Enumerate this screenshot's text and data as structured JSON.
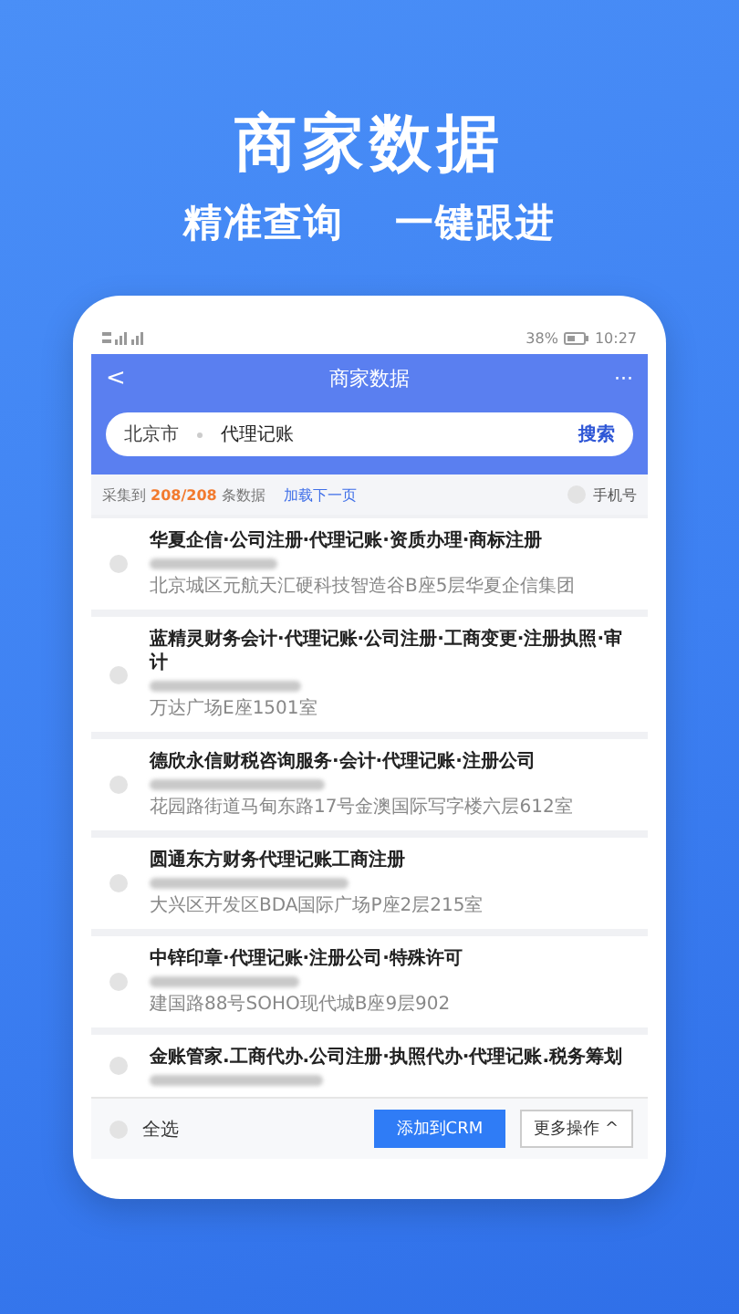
{
  "headline": "商家数据",
  "tagline": [
    "精准查询",
    "一键跟进"
  ],
  "status_bar": {
    "battery": "38%",
    "time": "10:27"
  },
  "app_bar": {
    "back": "<",
    "title": "商家数据",
    "more": "···"
  },
  "search": {
    "city": "北京市",
    "value": "代理记账",
    "button": "搜索"
  },
  "summary": {
    "prefix": "采集到",
    "count": "208/208",
    "suffix": "条数据",
    "next_page": "加载下一页",
    "phone_filter": {
      "label": "手机号",
      "checked": false
    }
  },
  "results": [
    {
      "title": "华夏企信·公司注册·代理记账·资质办理·商标注册",
      "address": "北京城区元航天汇硬科技智造谷B座5层华夏企信集团",
      "selected": false
    },
    {
      "title": "蓝精灵财务会计·代理记账·公司注册·工商变更·注册执照·审计",
      "address": "万达广场E座1501室",
      "selected": false
    },
    {
      "title": "德欣永信财税咨询服务·会计·代理记账·注册公司",
      "address": "花园路街道马甸东路17号金澳国际写字楼六层612室",
      "selected": false
    },
    {
      "title": "圆通东方财务代理记账工商注册",
      "address": "大兴区开发区BDA国际广场P座2层215室",
      "selected": false
    },
    {
      "title": "中锌印章·代理记账·注册公司·特殊许可",
      "address": "建国路88号SOHO现代城B座9层902",
      "selected": false
    },
    {
      "title": "金账管家.工商代办.公司注册·执照代办·代理记账.税务筹划",
      "selected": false
    }
  ],
  "bottom_bar": {
    "select_all": {
      "label": "全选",
      "checked": false
    },
    "add_button": "添加到CRM",
    "more_button": "更多操作 ^"
  }
}
